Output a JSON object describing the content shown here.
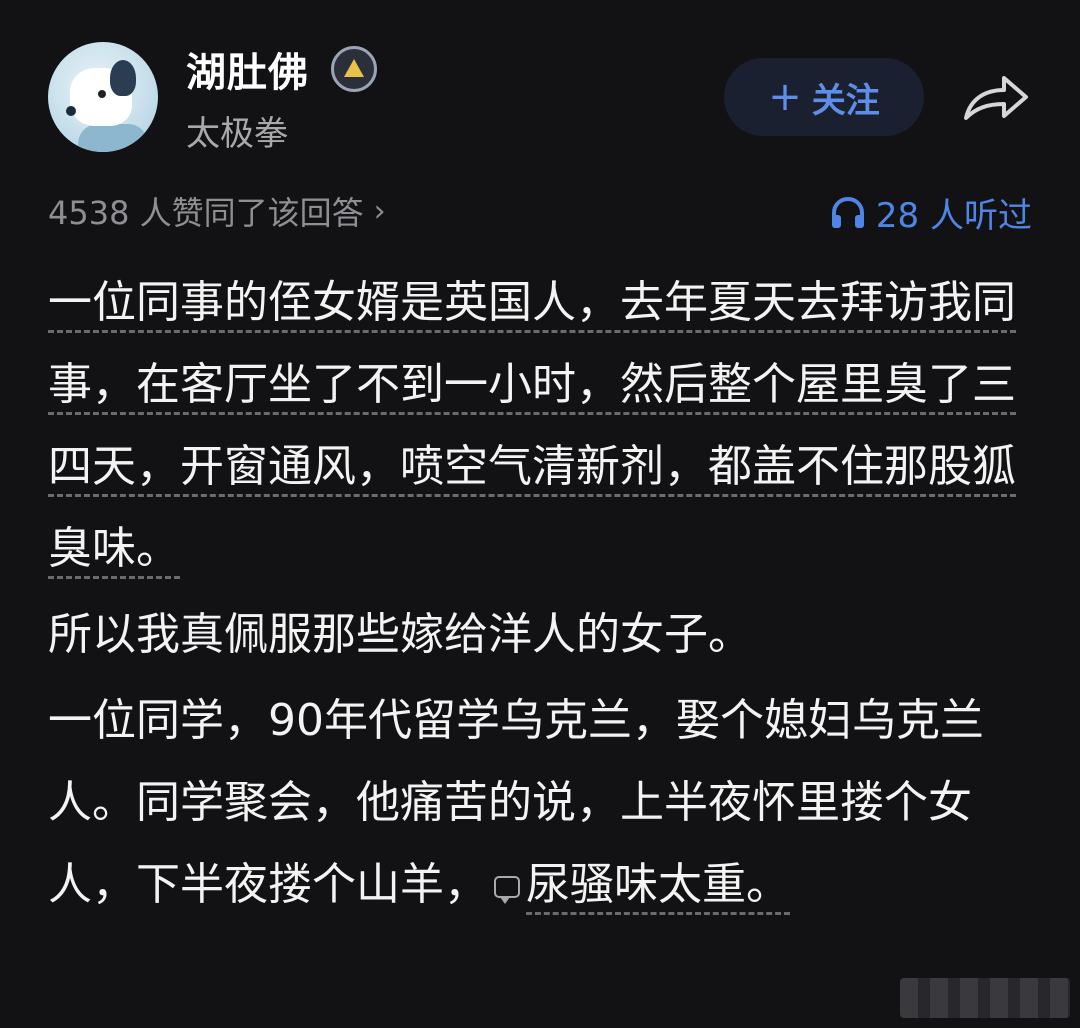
{
  "author": {
    "name": "湖肚佛",
    "tag": "太极拳",
    "avatar_icon": "polar-bear-avatar",
    "badge_icon": "medal-badge-icon"
  },
  "actions": {
    "follow_plus": "+",
    "follow_label": "关注",
    "share_icon": "share-arrow-icon"
  },
  "stats": {
    "agree_text": "4538 人赞同了该回答",
    "agree_chevron": "›",
    "listened_icon": "headphones-icon",
    "listened_text": "28 人听过"
  },
  "paragraphs": {
    "p1": "一位同事的侄女婿是英国人，去年夏天去拜访我同事，在客厅坐了不到一小时，然后整个屋里臭了三四天，开窗通风，喷空气清新剂，都盖不住那股狐臭味。",
    "p2": "所以我真佩服那些嫁给洋人的女子。",
    "p3a": "一位同学，90年代留学乌克兰，娶个媳妇乌克兰人。同学聚会，他痛苦的说，上半夜怀里搂个女人，下半夜搂个山羊，",
    "p3b": "尿骚味太重。"
  },
  "colors": {
    "background": "#121214",
    "accent_blue": "#4f86e6",
    "muted_text": "#8e8e93"
  }
}
